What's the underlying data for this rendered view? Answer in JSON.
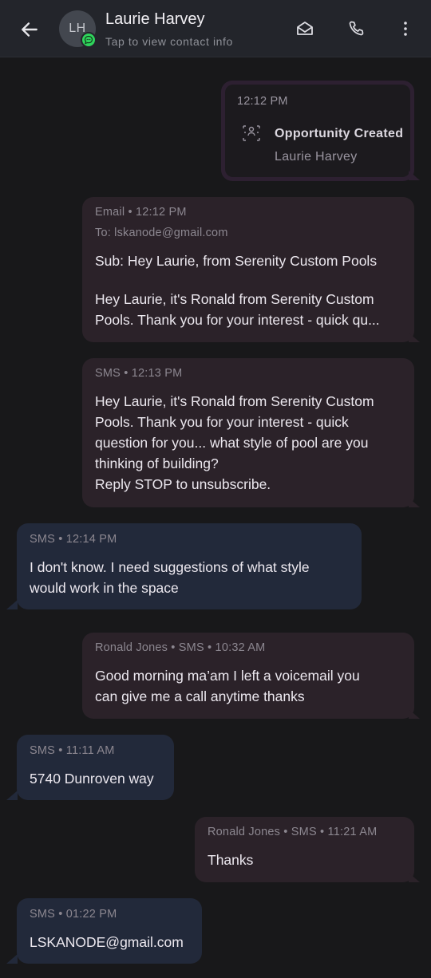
{
  "header": {
    "initials": "LH",
    "name": "Laurie Harvey",
    "subtitle": "Tap to view contact info"
  },
  "icons": {
    "back": "arrow-left-icon",
    "badge": "chat-bubble-icon",
    "email": "envelope-icon",
    "call": "phone-icon",
    "more": "more-vertical-icon",
    "event": "opportunity-icon"
  },
  "colors": {
    "background": "#18181a",
    "header": "#23252b",
    "outgoing_bubble": "#2b2229",
    "incoming_bubble": "#22293a",
    "badge": "#2fd45c",
    "event_border": "#2d2031"
  },
  "event": {
    "time": "12:12 PM",
    "title": "Opportunity Created",
    "subtitle": "Laurie Harvey"
  },
  "messages": [
    {
      "meta": "Email • 12:12 PM",
      "to": "To: lskanode@gmail.com",
      "subject": "Sub: Hey Laurie, from Serenity Custom Pools",
      "lines": [
        "Hey Laurie, it's Ronald from Serenity Custom",
        "Pools. Thank you for your interest - quick qu..."
      ]
    },
    {
      "meta": "SMS • 12:13 PM",
      "lines": [
        "Hey Laurie, it's Ronald from Serenity Custom",
        "Pools. Thank you for your interest - quick",
        "question for you... what style of pool are you",
        "thinking of building?",
        "Reply STOP to unsubscribe."
      ]
    },
    {
      "meta": "SMS • 12:14 PM",
      "lines": [
        "I don't know.  I need suggestions of what style",
        "would work in the space"
      ]
    },
    {
      "meta": "Ronald  Jones • SMS • 10:32 AM",
      "lines": [
        "Good morning ma’am  I left a voicemail you",
        "can give me a call anytime thanks"
      ]
    },
    {
      "meta": "SMS • 11:11 AM",
      "lines": [
        "5740 Dunroven way"
      ]
    },
    {
      "meta": "Ronald  Jones • SMS • 11:21 AM",
      "lines": [
        "Thanks"
      ]
    },
    {
      "meta": "SMS • 01:22 PM",
      "lines": [
        "LSKANODE@gmail.com"
      ]
    }
  ]
}
